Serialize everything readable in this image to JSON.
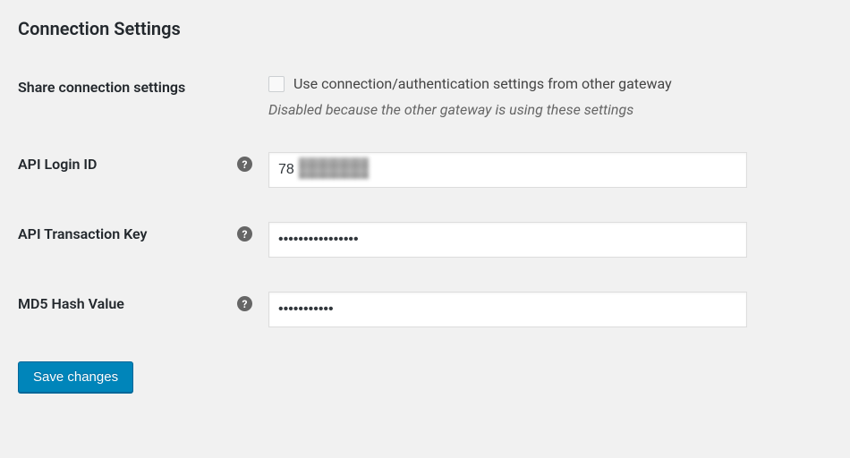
{
  "section": {
    "title": "Connection Settings"
  },
  "share": {
    "label": "Share connection settings",
    "checkbox_label": "Use connection/authentication settings from other gateway",
    "hint": "Disabled because the other gateway is using these settings"
  },
  "api_login": {
    "label": "API Login ID",
    "value": "78"
  },
  "api_txn_key": {
    "label": "API Transaction Key",
    "value": "••••••••••••••••"
  },
  "md5_hash": {
    "label": "MD5 Hash Value",
    "value": "•••••••••••"
  },
  "save": {
    "label": "Save changes"
  }
}
